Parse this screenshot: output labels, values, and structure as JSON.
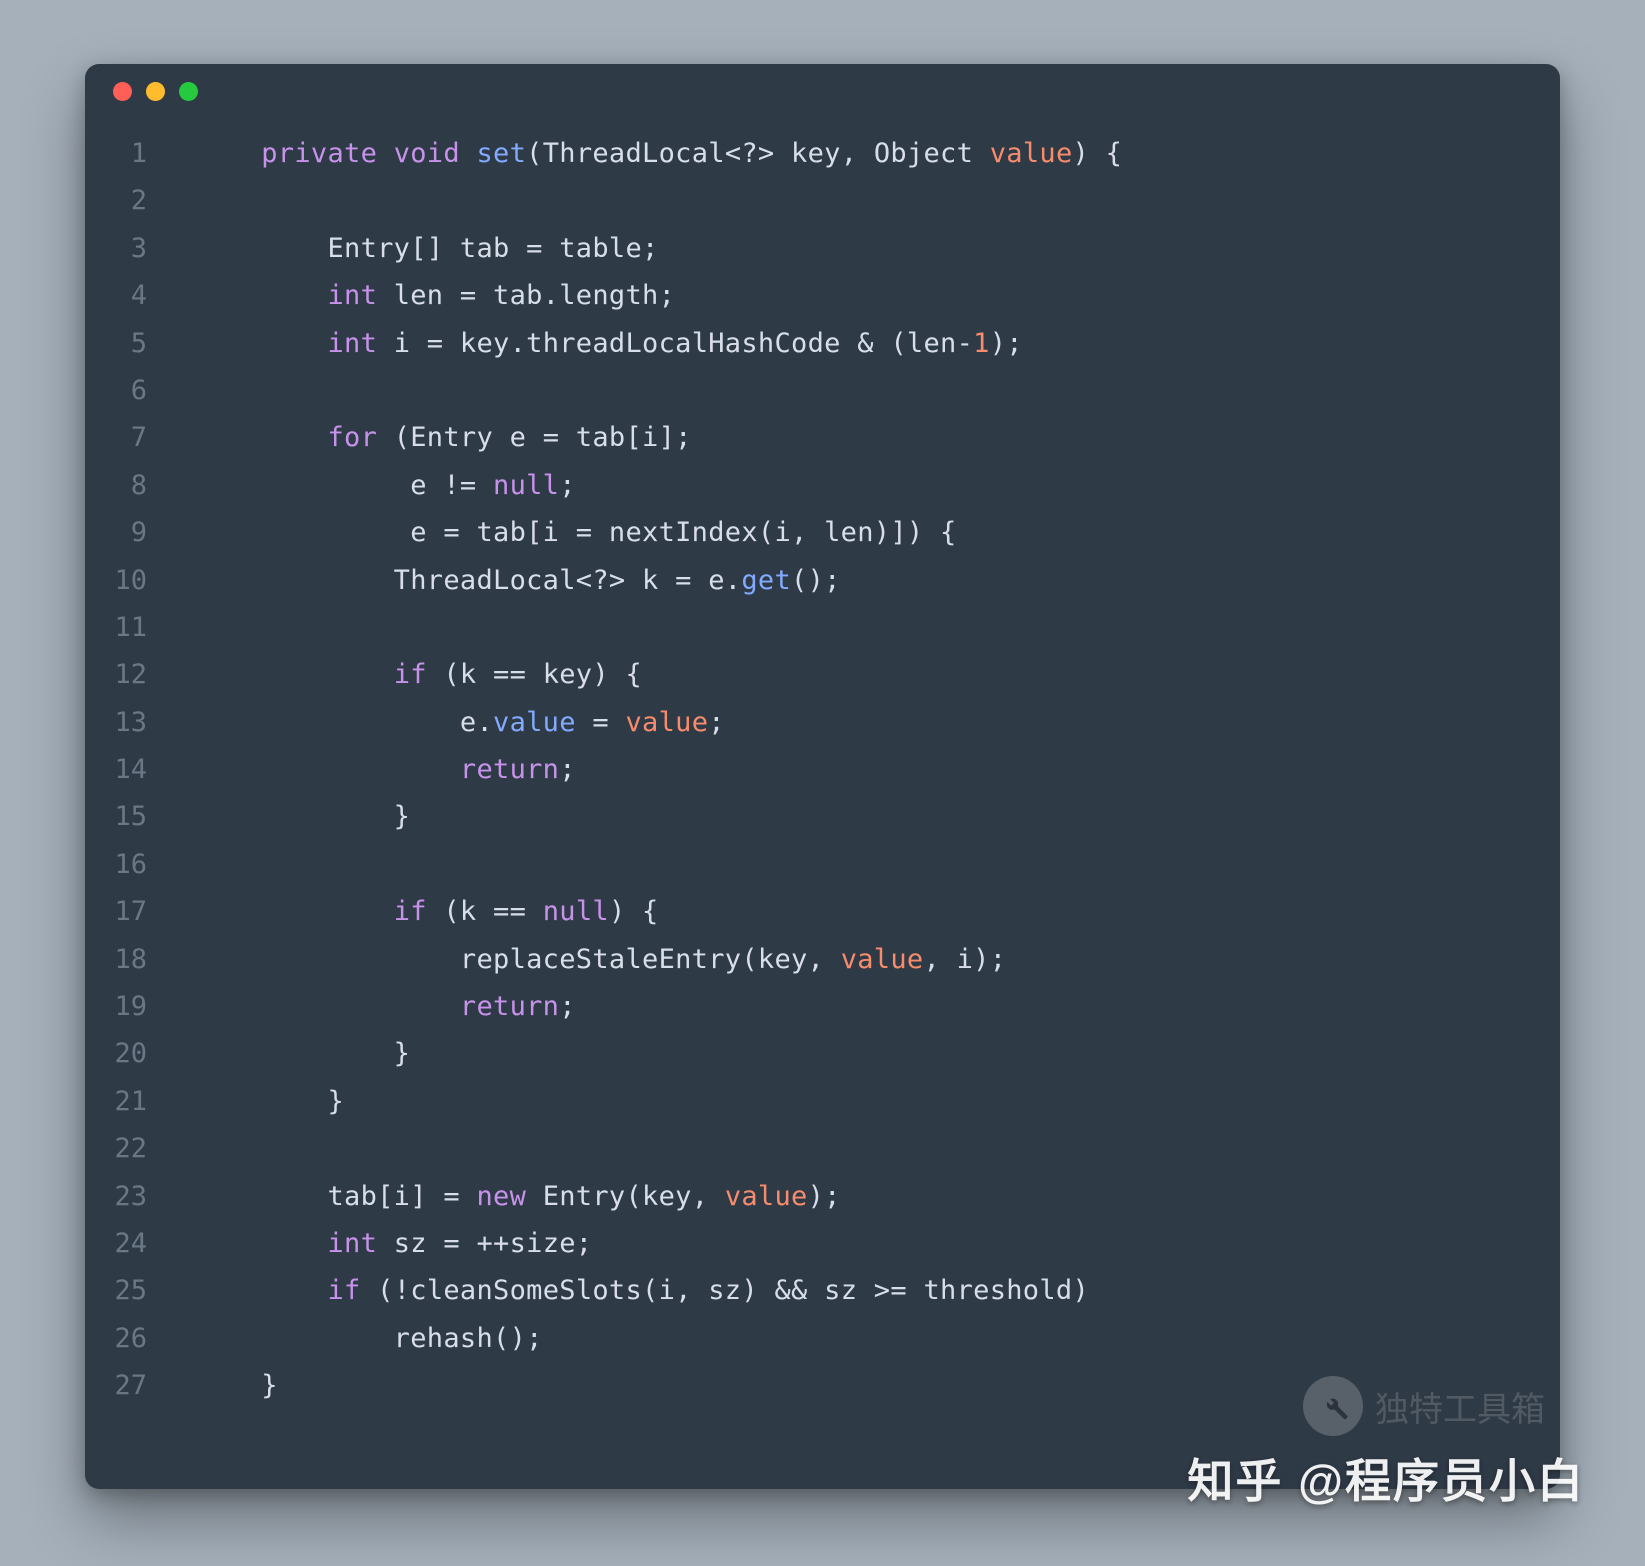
{
  "window": {
    "traffic_lights": [
      "red",
      "yellow",
      "green"
    ]
  },
  "code": {
    "lines": [
      {
        "n": "1",
        "tokens": [
          {
            "t": "private",
            "c": "kw"
          },
          {
            "t": " ",
            "c": "plain"
          },
          {
            "t": "void",
            "c": "kw"
          },
          {
            "t": " ",
            "c": "plain"
          },
          {
            "t": "set",
            "c": "fn"
          },
          {
            "t": "(ThreadLocal<?> key, Object ",
            "c": "plain"
          },
          {
            "t": "value",
            "c": "param"
          },
          {
            "t": ") {",
            "c": "plain"
          }
        ]
      },
      {
        "n": "2",
        "tokens": []
      },
      {
        "n": "3",
        "tokens": [
          {
            "t": "    Entry[] tab = table;",
            "c": "plain"
          }
        ]
      },
      {
        "n": "4",
        "tokens": [
          {
            "t": "    ",
            "c": "plain"
          },
          {
            "t": "int",
            "c": "kw"
          },
          {
            "t": " len = tab.length;",
            "c": "plain"
          }
        ]
      },
      {
        "n": "5",
        "tokens": [
          {
            "t": "    ",
            "c": "plain"
          },
          {
            "t": "int",
            "c": "kw"
          },
          {
            "t": " i = key.threadLocalHashCode & (len-",
            "c": "plain"
          },
          {
            "t": "1",
            "c": "num"
          },
          {
            "t": ");",
            "c": "plain"
          }
        ]
      },
      {
        "n": "6",
        "tokens": []
      },
      {
        "n": "7",
        "tokens": [
          {
            "t": "    ",
            "c": "plain"
          },
          {
            "t": "for",
            "c": "kw"
          },
          {
            "t": " (Entry e = tab[i];",
            "c": "plain"
          }
        ]
      },
      {
        "n": "8",
        "tokens": [
          {
            "t": "         e != ",
            "c": "plain"
          },
          {
            "t": "null",
            "c": "lit-null"
          },
          {
            "t": ";",
            "c": "plain"
          }
        ]
      },
      {
        "n": "9",
        "tokens": [
          {
            "t": "         e = tab[i = nextIndex(i, len)]) {",
            "c": "plain"
          }
        ]
      },
      {
        "n": "10",
        "tokens": [
          {
            "t": "        ThreadLocal<?> k = e.",
            "c": "plain"
          },
          {
            "t": "get",
            "c": "fn"
          },
          {
            "t": "();",
            "c": "plain"
          }
        ]
      },
      {
        "n": "11",
        "tokens": []
      },
      {
        "n": "12",
        "tokens": [
          {
            "t": "        ",
            "c": "plain"
          },
          {
            "t": "if",
            "c": "kw"
          },
          {
            "t": " (k == key) {",
            "c": "plain"
          }
        ]
      },
      {
        "n": "13",
        "tokens": [
          {
            "t": "            e.",
            "c": "plain"
          },
          {
            "t": "value",
            "c": "prop"
          },
          {
            "t": " = ",
            "c": "plain"
          },
          {
            "t": "value",
            "c": "param"
          },
          {
            "t": ";",
            "c": "plain"
          }
        ]
      },
      {
        "n": "14",
        "tokens": [
          {
            "t": "            ",
            "c": "plain"
          },
          {
            "t": "return",
            "c": "kw"
          },
          {
            "t": ";",
            "c": "plain"
          }
        ]
      },
      {
        "n": "15",
        "tokens": [
          {
            "t": "        }",
            "c": "plain"
          }
        ]
      },
      {
        "n": "16",
        "tokens": []
      },
      {
        "n": "17",
        "tokens": [
          {
            "t": "        ",
            "c": "plain"
          },
          {
            "t": "if",
            "c": "kw"
          },
          {
            "t": " (k == ",
            "c": "plain"
          },
          {
            "t": "null",
            "c": "lit-null"
          },
          {
            "t": ") {",
            "c": "plain"
          }
        ]
      },
      {
        "n": "18",
        "tokens": [
          {
            "t": "            replaceStaleEntry(key, ",
            "c": "plain"
          },
          {
            "t": "value",
            "c": "param"
          },
          {
            "t": ", i);",
            "c": "plain"
          }
        ]
      },
      {
        "n": "19",
        "tokens": [
          {
            "t": "            ",
            "c": "plain"
          },
          {
            "t": "return",
            "c": "kw"
          },
          {
            "t": ";",
            "c": "plain"
          }
        ]
      },
      {
        "n": "20",
        "tokens": [
          {
            "t": "        }",
            "c": "plain"
          }
        ]
      },
      {
        "n": "21",
        "tokens": [
          {
            "t": "    }",
            "c": "plain"
          }
        ]
      },
      {
        "n": "22",
        "tokens": []
      },
      {
        "n": "23",
        "tokens": [
          {
            "t": "    tab[i] = ",
            "c": "plain"
          },
          {
            "t": "new",
            "c": "kw"
          },
          {
            "t": " Entry(key, ",
            "c": "plain"
          },
          {
            "t": "value",
            "c": "param"
          },
          {
            "t": ");",
            "c": "plain"
          }
        ]
      },
      {
        "n": "24",
        "tokens": [
          {
            "t": "    ",
            "c": "plain"
          },
          {
            "t": "int",
            "c": "kw"
          },
          {
            "t": " sz = ++size;",
            "c": "plain"
          }
        ]
      },
      {
        "n": "25",
        "tokens": [
          {
            "t": "    ",
            "c": "plain"
          },
          {
            "t": "if",
            "c": "kw"
          },
          {
            "t": " (!cleanSomeSlots(i, sz) && sz >= threshold)",
            "c": "plain"
          }
        ]
      },
      {
        "n": "26",
        "tokens": [
          {
            "t": "        rehash();",
            "c": "plain"
          }
        ]
      },
      {
        "n": "27",
        "tokens": [
          {
            "t": "}",
            "c": "plain"
          }
        ]
      }
    ],
    "indent_prefix": "    "
  },
  "watermarks": {
    "badge_text": "独特工具箱",
    "bottom_text": "知乎 @程序员小白"
  }
}
